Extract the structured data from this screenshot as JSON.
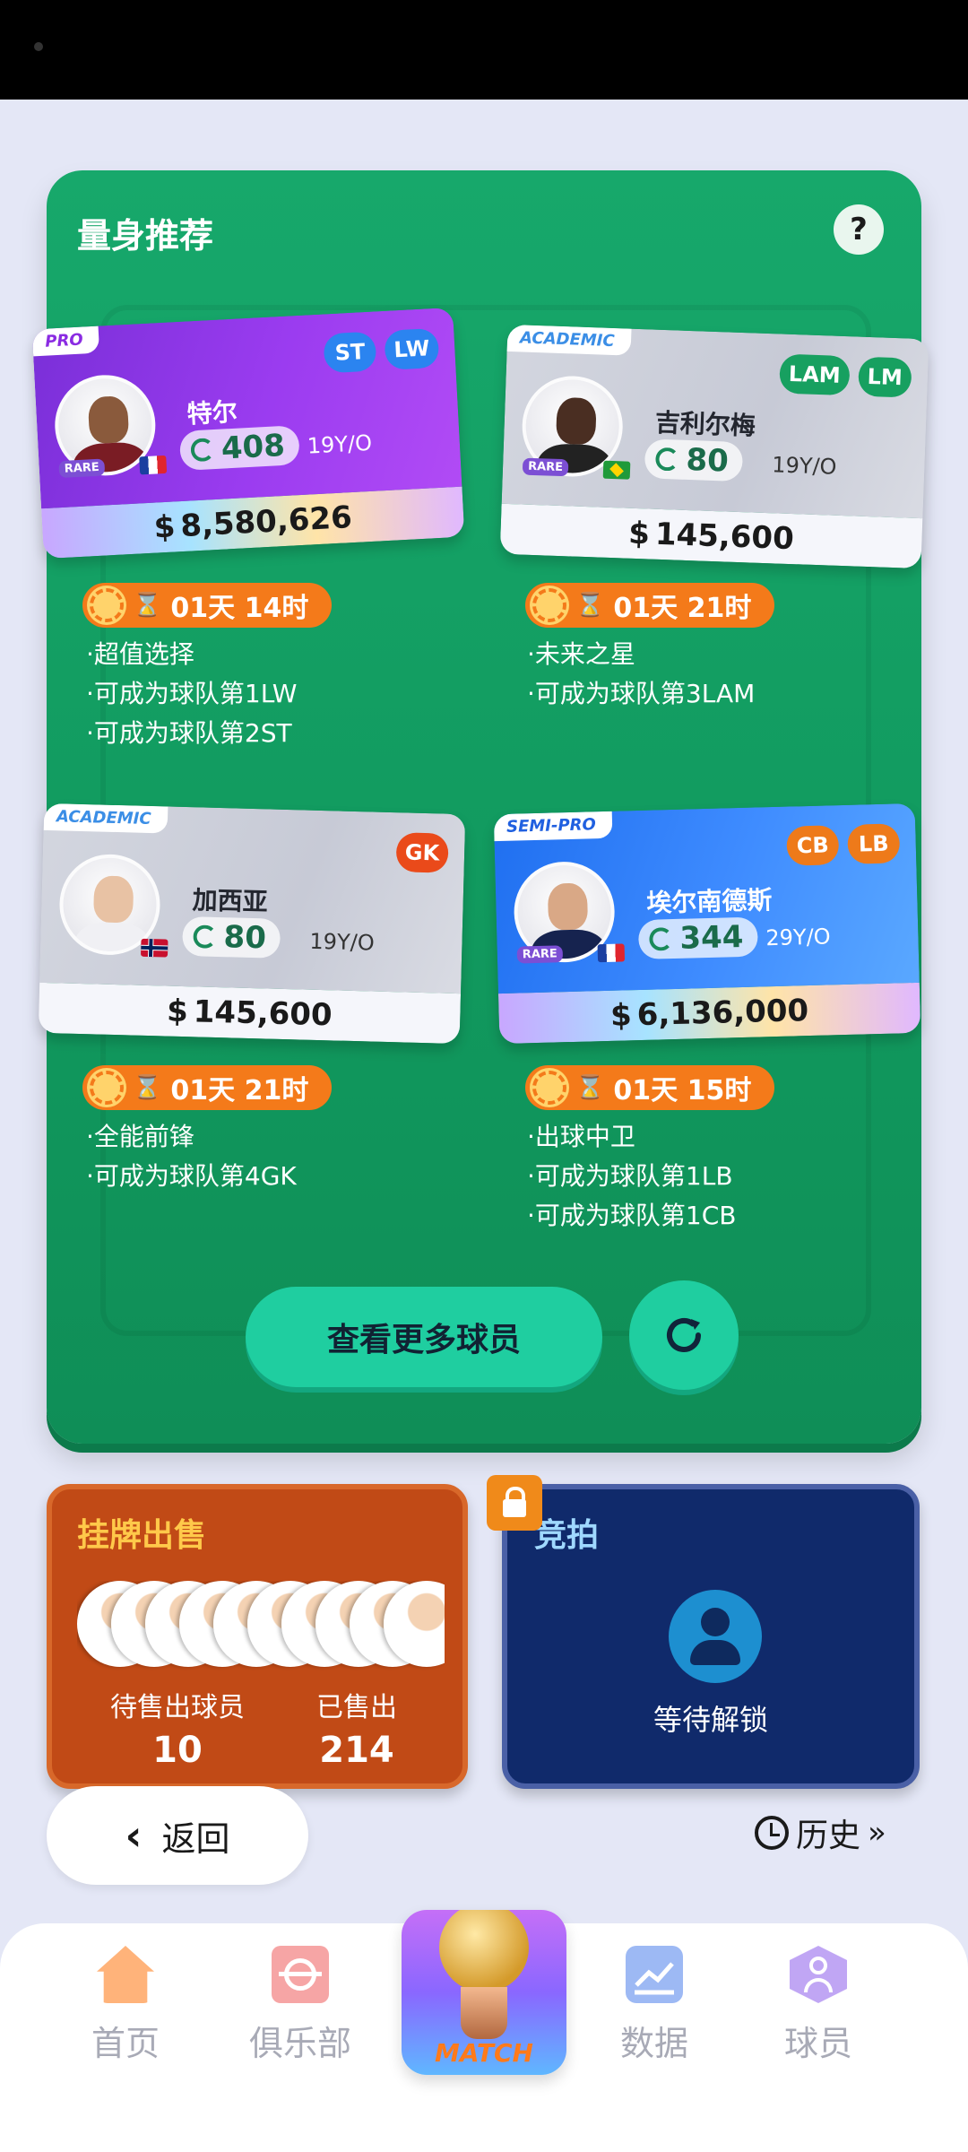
{
  "panel": {
    "title": "量身推荐",
    "help": "?",
    "more_button": "查看更多球员"
  },
  "cards": [
    {
      "tier": "PRO",
      "name": "特尔",
      "rating": "408",
      "age": "19Y/O",
      "rare": "RARE",
      "positions": [
        "ST",
        "LW"
      ],
      "price": "8,580,626",
      "timer": "01天 14时",
      "tips": [
        "·超值选择",
        "·可成为球队第1LW",
        "·可成为球队第2ST"
      ]
    },
    {
      "tier": "ACADEMIC",
      "name": "吉利尔梅",
      "rating": "80",
      "age": "19Y/O",
      "rare": "RARE",
      "positions": [
        "LAM",
        "LM"
      ],
      "price": "145,600",
      "timer": "01天 21时",
      "tips": [
        "·未来之星",
        "·可成为球队第3LAM"
      ]
    },
    {
      "tier": "ACADEMIC",
      "name": "加西亚",
      "rating": "80",
      "age": "19Y/O",
      "positions": [
        "GK"
      ],
      "price": "145,600",
      "timer": "01天 21时",
      "tips": [
        "·全能前锋",
        "·可成为球队第4GK"
      ]
    },
    {
      "tier": "SEMI-PRO",
      "name": "埃尔南德斯",
      "rating": "344",
      "age": "29Y/O",
      "rare": "RARE",
      "positions": [
        "CB",
        "LB"
      ],
      "price": "6,136,000",
      "timer": "01天 15时",
      "tips": [
        "·出球中卫",
        "·可成为球队第1LB",
        "·可成为球队第1CB"
      ]
    }
  ],
  "currency": "$",
  "sale": {
    "title": "挂牌出售",
    "pending_label": "待售出球员",
    "pending_value": "10",
    "sold_label": "已售出",
    "sold_value": "214"
  },
  "auction": {
    "title": "竞拍",
    "status": "等待解锁"
  },
  "back_label": "返回",
  "history_label": "历史",
  "tabs": {
    "home": "首页",
    "club": "俱乐部",
    "match": "MATCH",
    "data": "数据",
    "players": "球员"
  },
  "colors": {
    "panel_green": "#17a86b",
    "timer_orange": "#f47a1a",
    "button_teal": "#1fcea0",
    "sale_brown": "#c14a16",
    "auction_navy": "#102a6b"
  }
}
